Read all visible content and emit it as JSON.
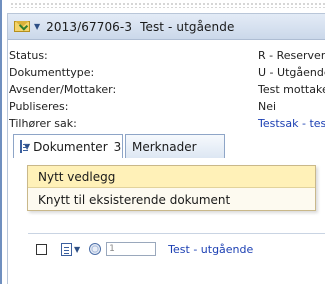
{
  "header": {
    "case_number": "2013/67706-3",
    "title": "Test - utgående"
  },
  "fields": [
    {
      "label": "Status:",
      "value": "R - Reservert"
    },
    {
      "label": "Dokumenttype:",
      "value": "U - Utgående"
    },
    {
      "label": "Avsender/Mottaker:",
      "value": "Test mottaker"
    },
    {
      "label": "Publiseres:",
      "value": "Nei"
    },
    {
      "label": "Tilhører sak:",
      "value": "Testsak - test"
    }
  ],
  "tabs": [
    {
      "label": "Dokumenter",
      "count": "3"
    },
    {
      "label": "Merknader"
    }
  ],
  "menu": [
    {
      "label": "Nytt vedlegg"
    },
    {
      "label": "Knytt til eksisterende dokument"
    }
  ],
  "document_row": {
    "number": "1",
    "title": "Test - utgående"
  },
  "colors": {
    "link": "#1b3fb3",
    "menu_highlight": "#fff1b8",
    "titlebar": "#cbd8ea"
  },
  "icons": [
    "envelope-arrow-icon",
    "chevron-down-icon",
    "document-icon",
    "attachment-icon",
    "checkbox"
  ]
}
